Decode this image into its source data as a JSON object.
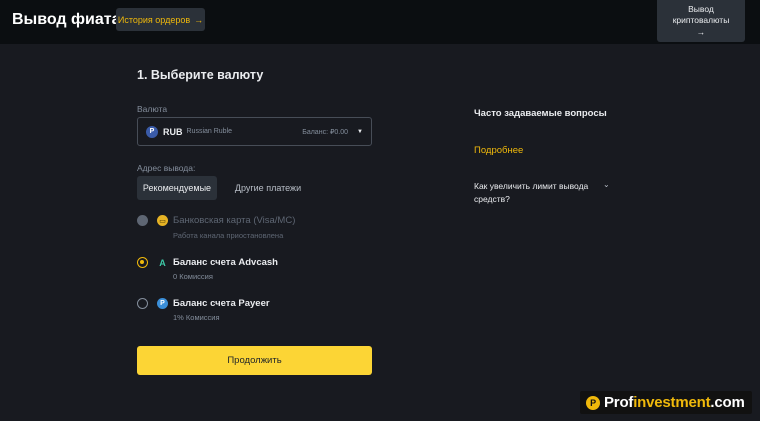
{
  "header": {
    "title": "Вывод фиата",
    "history_button": "История ордеров",
    "arrow": "→",
    "crypto_button_line1": "Вывод",
    "crypto_button_line2": "криптовалюты"
  },
  "step": {
    "title": "1. Выберите валюту",
    "currency_label": "Валюта",
    "currency": {
      "icon_letter": "P",
      "code": "RUB",
      "name": "Russian Ruble",
      "balance": "Баланс: ₽0.00",
      "caret": "▼"
    },
    "address_label": "Адрес вывода:",
    "tabs": [
      {
        "label": "Рекомендуемые",
        "active": true
      },
      {
        "label": "Другие платежи",
        "active": false
      }
    ],
    "methods": [
      {
        "title": "Банковская карта (Visa/MC)",
        "subtitle": "Работа канала приостановлена",
        "state": "disabled",
        "icon": "bank-card-icon",
        "glyph": "▭",
        "icon_color": "#e6b325"
      },
      {
        "title": "Баланс счета Advcash",
        "subtitle": "0 Комиссия",
        "state": "selected",
        "icon": "advcash-icon",
        "glyph": "A",
        "icon_color": "#3ec9a7"
      },
      {
        "title": "Баланс счета Payeer",
        "subtitle": "1% Комиссия",
        "state": "unselected",
        "icon": "payeer-icon",
        "glyph": "P",
        "icon_color": "#3b8fd9"
      }
    ],
    "continue_button": "Продолжить"
  },
  "faq": {
    "title": "Часто задаваемые вопросы",
    "more_link": "Подробнее",
    "question": "Как увеличить лимит вывода средств?",
    "chevron": "⌄"
  },
  "watermark": {
    "logo_letter": "P",
    "prefix": "Prof",
    "accent": "investment",
    "suffix": ".com"
  },
  "colors": {
    "background": "#181a20",
    "accent": "#f0b90b",
    "button": "#fcd535"
  }
}
